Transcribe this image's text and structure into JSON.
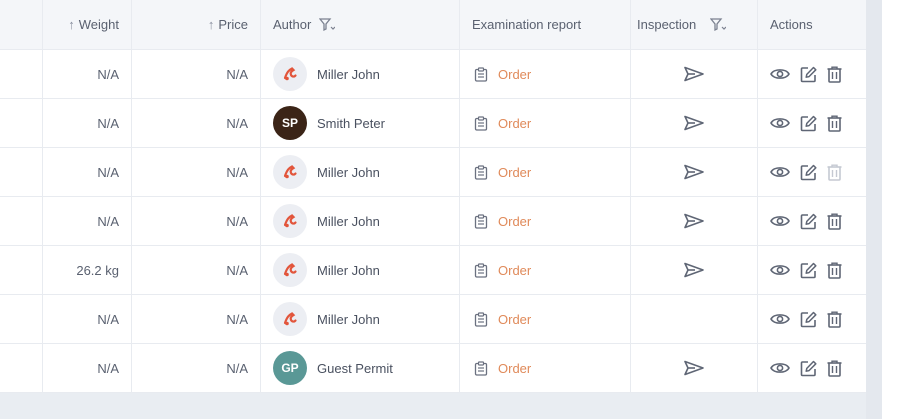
{
  "table": {
    "headers": {
      "weight": "Weight",
      "price": "Price",
      "author": "Author",
      "examination_report": "Examination report",
      "inspection": "Inspection",
      "actions": "Actions"
    },
    "rows": [
      {
        "weight": "N/A",
        "price": "N/A",
        "author": "Miller John",
        "avatar": "logo",
        "initials": "",
        "report": "Order",
        "inspection": true,
        "delete_enabled": true
      },
      {
        "weight": "N/A",
        "price": "N/A",
        "author": "Smith Peter",
        "avatar": "sp",
        "initials": "SP",
        "report": "Order",
        "inspection": true,
        "delete_enabled": true
      },
      {
        "weight": "N/A",
        "price": "N/A",
        "author": "Miller John",
        "avatar": "logo",
        "initials": "",
        "report": "Order",
        "inspection": true,
        "delete_enabled": false
      },
      {
        "weight": "N/A",
        "price": "N/A",
        "author": "Miller John",
        "avatar": "logo",
        "initials": "",
        "report": "Order",
        "inspection": true,
        "delete_enabled": true
      },
      {
        "weight": "26.2 kg",
        "price": "N/A",
        "author": "Miller John",
        "avatar": "logo",
        "initials": "",
        "report": "Order",
        "inspection": true,
        "delete_enabled": true
      },
      {
        "weight": "N/A",
        "price": "N/A",
        "author": "Miller John",
        "avatar": "logo",
        "initials": "",
        "report": "Order",
        "inspection": false,
        "delete_enabled": true
      },
      {
        "weight": "N/A",
        "price": "N/A",
        "author": "Guest Permit",
        "avatar": "gp",
        "initials": "GP",
        "report": "Order",
        "inspection": true,
        "delete_enabled": true
      }
    ]
  },
  "colors": {
    "link": "#e08a5a",
    "icon": "#5f6675",
    "icon_disabled": "#c5c9d2",
    "header_bg": "#f4f6f9",
    "avatar_sp": "#3b2417",
    "avatar_gp": "#5a9896",
    "logo_red": "#e2553b"
  },
  "icons": {
    "sort": "arrow-up-icon",
    "filter": "filter-icon",
    "report": "clipboard-icon",
    "inspection": "send-icon",
    "view": "eye-icon",
    "edit": "edit-icon",
    "delete": "trash-icon"
  }
}
